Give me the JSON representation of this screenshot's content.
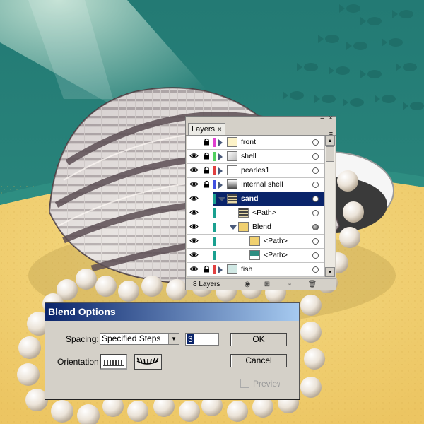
{
  "layers_panel": {
    "tab_label": "Layers",
    "tab_close": "×",
    "minimize": "–",
    "close": "×",
    "menu_glyph": "≡",
    "rows": [
      {
        "name": "front",
        "tag_color": "#e040d0",
        "locked": true,
        "expand": "closed",
        "thumb": "front",
        "target": "empty",
        "selected": false,
        "visible": false
      },
      {
        "name": "shell",
        "tag_color": "#50d060",
        "locked": true,
        "expand": "closed",
        "thumb": "shell",
        "target": "empty",
        "selected": false,
        "visible": true
      },
      {
        "name": "pearles1",
        "tag_color": "#e04040",
        "locked": true,
        "expand": "closed",
        "thumb": "blank",
        "target": "empty",
        "selected": false,
        "visible": true
      },
      {
        "name": "Internal shell",
        "tag_color": "#4050e0",
        "locked": true,
        "expand": "closed",
        "thumb": "internal",
        "target": "empty",
        "selected": false,
        "visible": true
      },
      {
        "name": "sand",
        "tag_color": "#1aa090",
        "locked": false,
        "expand": "open",
        "thumb": "sand",
        "target": "empty",
        "selected": true,
        "visible": true
      },
      {
        "name": "<Path>",
        "tag_color": "#1aa090",
        "locked": false,
        "expand": "none",
        "thumb": "path",
        "target": "empty",
        "selected": false,
        "visible": true
      },
      {
        "name": "Blend",
        "tag_color": "#1aa090",
        "locked": false,
        "expand": "open",
        "thumb": "blend",
        "target": "filled",
        "selected": false,
        "visible": true
      },
      {
        "name": "<Path>",
        "tag_color": "#1aa090",
        "locked": false,
        "expand": "none",
        "thumb": "yellow",
        "target": "empty",
        "selected": false,
        "visible": true
      },
      {
        "name": "<Path>",
        "tag_color": "#1aa090",
        "locked": false,
        "expand": "none",
        "thumb": "teal",
        "target": "empty",
        "selected": false,
        "visible": true
      },
      {
        "name": "fish",
        "tag_color": "#e04040",
        "locked": true,
        "expand": "closed",
        "thumb": "fish",
        "target": "empty",
        "selected": false,
        "visible": true
      }
    ],
    "layer_count": "8 Layers",
    "footer_icons": [
      "make-clipping-mask-icon",
      "create-sublayer-icon",
      "create-layer-icon",
      "delete-layer-icon"
    ]
  },
  "blend_dialog": {
    "title": "Blend Options",
    "spacing_label": "Spacing:",
    "spacing_value": "Specified Steps",
    "steps_value": "3",
    "orientation_label": "Orientation:",
    "ok_label": "OK",
    "cancel_label": "Cancel",
    "preview_label": "Preview",
    "preview_checked": false
  },
  "colors": {
    "selection": "#0a246a",
    "dialog_title_start": "#0a246a",
    "dialog_title_end": "#a6caf0",
    "water": "#2a8a80",
    "sand": "#f0d070"
  }
}
